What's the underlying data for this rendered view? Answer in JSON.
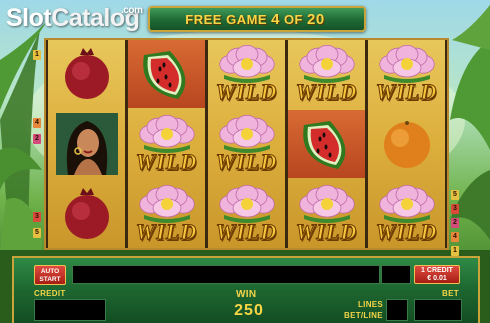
{
  "watermark": {
    "slot": "Slot",
    "catalog": "Catalog",
    "com": ".com"
  },
  "header": {
    "prefix": "FREE GAME",
    "current": "4",
    "of": "OF",
    "total": "20"
  },
  "reels": [
    [
      "pomegranate",
      "woman",
      "pomegranate"
    ],
    [
      "watermelon",
      "wild-lotus",
      "wild-lotus"
    ],
    [
      "wild-lotus",
      "wild-lotus",
      "wild-lotus"
    ],
    [
      "wild-lotus",
      "watermelon",
      "wild-lotus"
    ],
    [
      "wild-lotus",
      "orange",
      "wild-lotus"
    ]
  ],
  "wild_label": "WILD",
  "paylines": {
    "left": [
      "1",
      "4",
      "2",
      "3",
      "5"
    ],
    "right": [
      "5",
      "3",
      "2",
      "4",
      "1"
    ]
  },
  "panel": {
    "auto_start": {
      "line1": "AUTO",
      "line2": "START"
    },
    "credit_button": {
      "line1": "1 CREDIT",
      "line2": "€ 0.01"
    },
    "credit_label": "CREDIT",
    "bet_label": "BET",
    "win_label": "WIN",
    "win_value": "250",
    "lines_label": "LINES",
    "bet_line_label": "BET/LINE"
  },
  "colors": {
    "gold": "#f6d547",
    "panel_green": "#1d6630",
    "button_red": "#c0291e"
  }
}
